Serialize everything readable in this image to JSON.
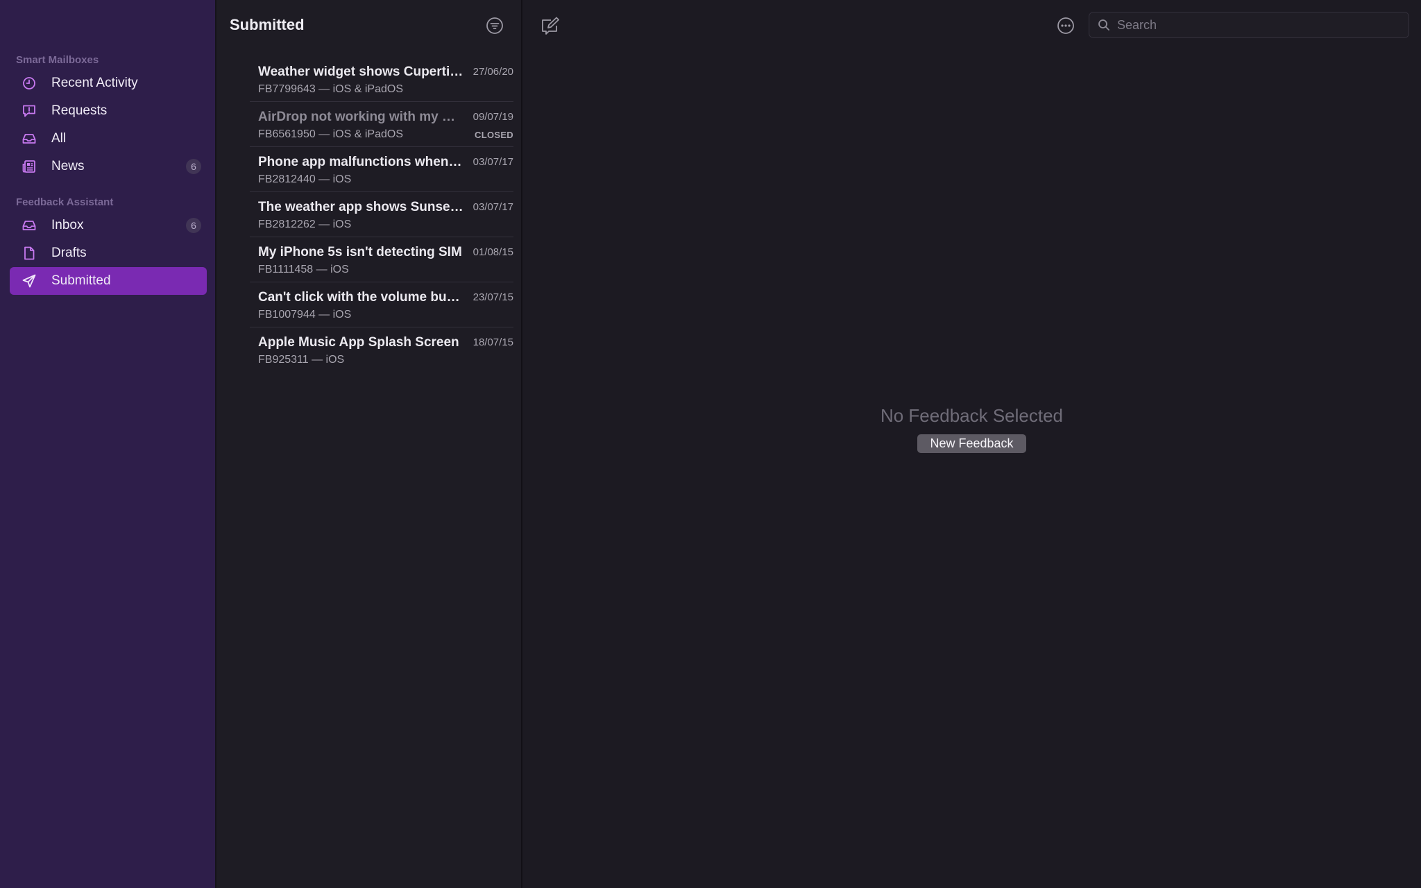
{
  "sidebar": {
    "smart_header": "Smart Mailboxes",
    "assistant_header": "Feedback Assistant",
    "items": [
      {
        "label": "Recent Activity",
        "count": "",
        "icon": "clock-icon"
      },
      {
        "label": "Requests",
        "count": "",
        "icon": "exclamation-bubble-icon"
      },
      {
        "label": "All",
        "count": "",
        "icon": "tray-icon"
      },
      {
        "label": "News",
        "count": "6",
        "icon": "newspaper-icon"
      },
      {
        "label": "Inbox",
        "count": "6",
        "icon": "tray-icon"
      },
      {
        "label": "Drafts",
        "count": "",
        "icon": "document-icon"
      },
      {
        "label": "Submitted",
        "count": "",
        "icon": "paperplane-icon"
      }
    ],
    "selected": "Submitted"
  },
  "list": {
    "title": "Submitted",
    "items": [
      {
        "title": "Weather widget shows Cupertino",
        "sub": "FB7799643 — iOS & iPadOS",
        "date": "27/06/20",
        "status": ""
      },
      {
        "title": "AirDrop not working with my Mac",
        "sub": "FB6561950 — iOS & iPadOS",
        "date": "09/07/19",
        "status": "CLOSED"
      },
      {
        "title": "Phone app malfunctions when calling",
        "sub": "FB2812440 — iOS",
        "date": "03/07/17",
        "status": ""
      },
      {
        "title": "The weather app shows Sunset time",
        "sub": "FB2812262 — iOS",
        "date": "03/07/17",
        "status": ""
      },
      {
        "title": "My iPhone 5s isn't detecting SIM",
        "sub": "FB1111458 — iOS",
        "date": "01/08/15",
        "status": ""
      },
      {
        "title": "Can't click with the volume buttons",
        "sub": "FB1007944 — iOS",
        "date": "23/07/15",
        "status": ""
      },
      {
        "title": "Apple Music App Splash Screen",
        "sub": "FB925311 — iOS",
        "date": "18/07/15",
        "status": ""
      }
    ]
  },
  "detail": {
    "empty_title": "No Feedback Selected",
    "new_button": "New Feedback",
    "search_placeholder": "Search"
  },
  "colors": {
    "sidebar_bg": "#2e1e4a",
    "accent": "#7a2ab2",
    "icon_accent": "#c879f0"
  }
}
